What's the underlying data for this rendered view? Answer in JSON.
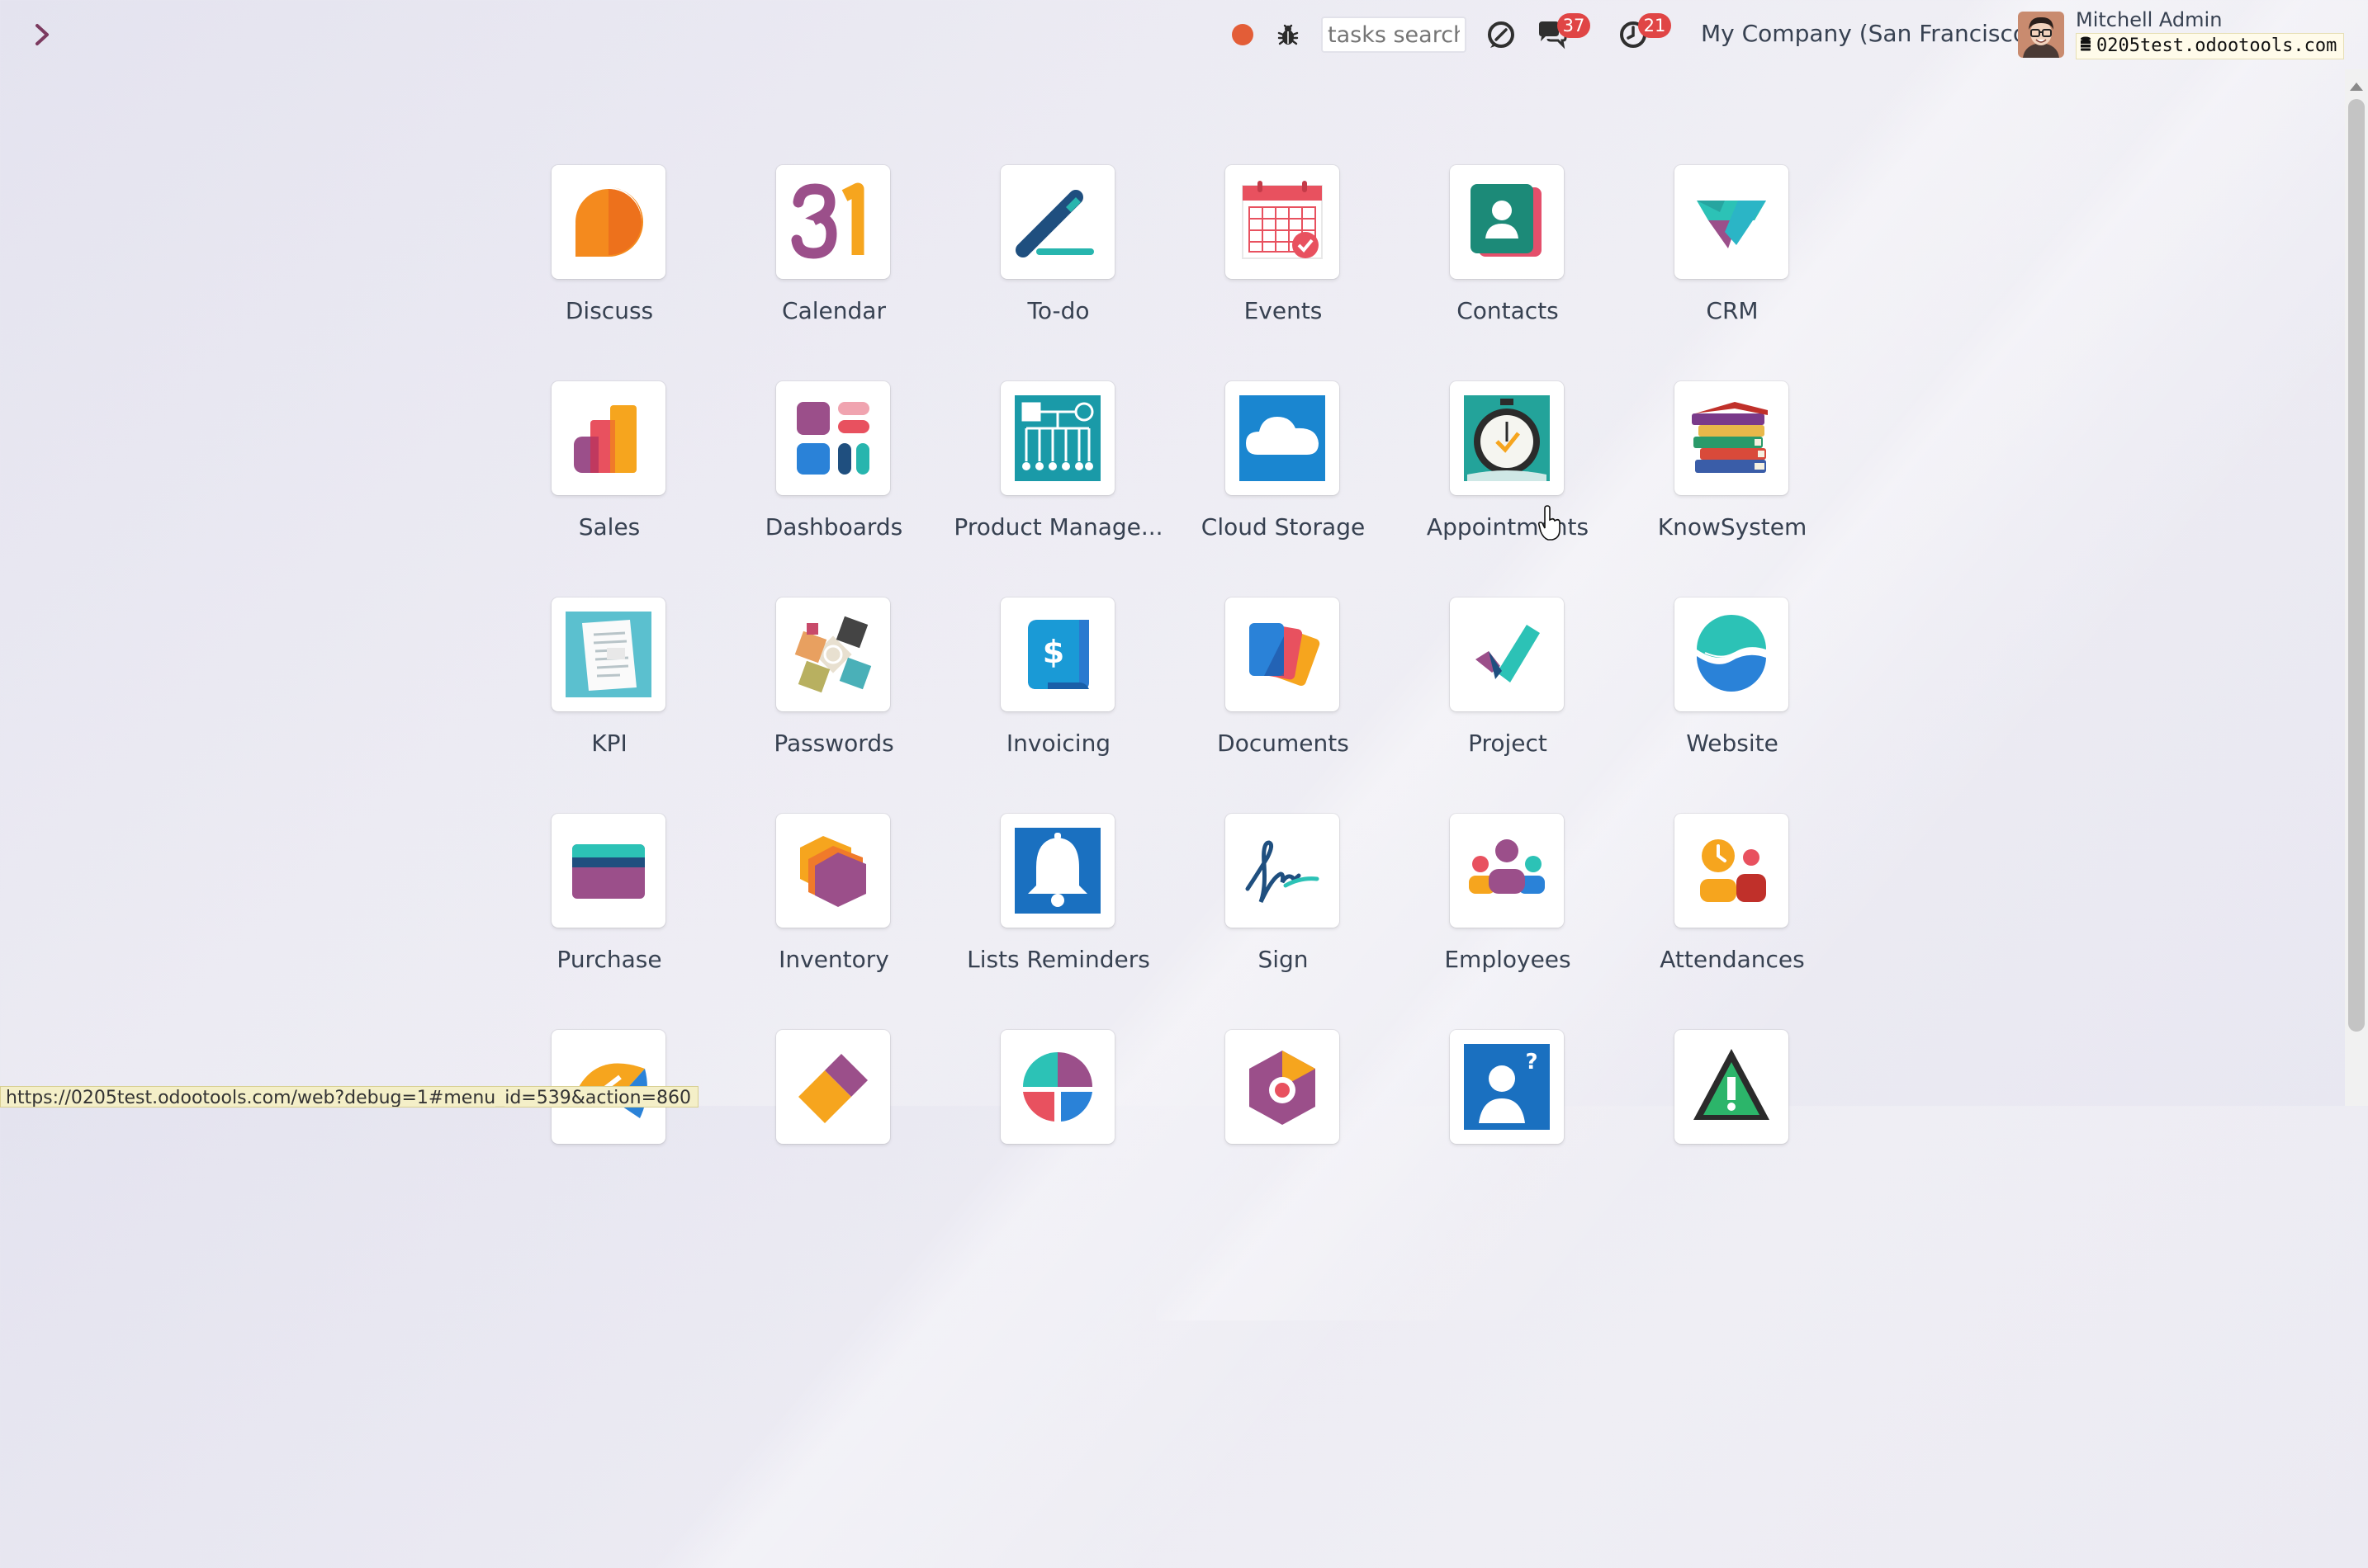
{
  "topbar": {
    "search_placeholder": "tasks search",
    "messages_count": "37",
    "activities_count": "21",
    "company": "My Company (San Francisco)",
    "user_name": "Mitchell Admin",
    "database": "0205test.odootools.com"
  },
  "apps": [
    {
      "label": "Discuss",
      "icon": "discuss-icon"
    },
    {
      "label": "Calendar",
      "icon": "calendar-icon"
    },
    {
      "label": "To-do",
      "icon": "todo-icon"
    },
    {
      "label": "Events",
      "icon": "events-icon"
    },
    {
      "label": "Contacts",
      "icon": "contacts-icon"
    },
    {
      "label": "CRM",
      "icon": "crm-icon"
    },
    {
      "label": "Sales",
      "icon": "sales-icon"
    },
    {
      "label": "Dashboards",
      "icon": "dashboards-icon"
    },
    {
      "label": "Product Manage...",
      "icon": "product-management-icon"
    },
    {
      "label": "Cloud Storage",
      "icon": "cloud-storage-icon"
    },
    {
      "label": "Appointments",
      "icon": "appointments-icon"
    },
    {
      "label": "KnowSystem",
      "icon": "knowsystem-icon"
    },
    {
      "label": "KPI",
      "icon": "kpi-icon"
    },
    {
      "label": "Passwords",
      "icon": "passwords-icon"
    },
    {
      "label": "Invoicing",
      "icon": "invoicing-icon"
    },
    {
      "label": "Documents",
      "icon": "documents-icon"
    },
    {
      "label": "Project",
      "icon": "project-icon"
    },
    {
      "label": "Website",
      "icon": "website-icon"
    },
    {
      "label": "Purchase",
      "icon": "purchase-icon"
    },
    {
      "label": "Inventory",
      "icon": "inventory-icon"
    },
    {
      "label": "Lists Reminders",
      "icon": "lists-reminders-icon"
    },
    {
      "label": "Sign",
      "icon": "sign-icon"
    },
    {
      "label": "Employees",
      "icon": "employees-icon"
    },
    {
      "label": "Attendances",
      "icon": "attendances-icon"
    }
  ],
  "status_bar": {
    "url": "https://0205test.odootools.com/web?debug=1#menu_id=539&action=860"
  }
}
